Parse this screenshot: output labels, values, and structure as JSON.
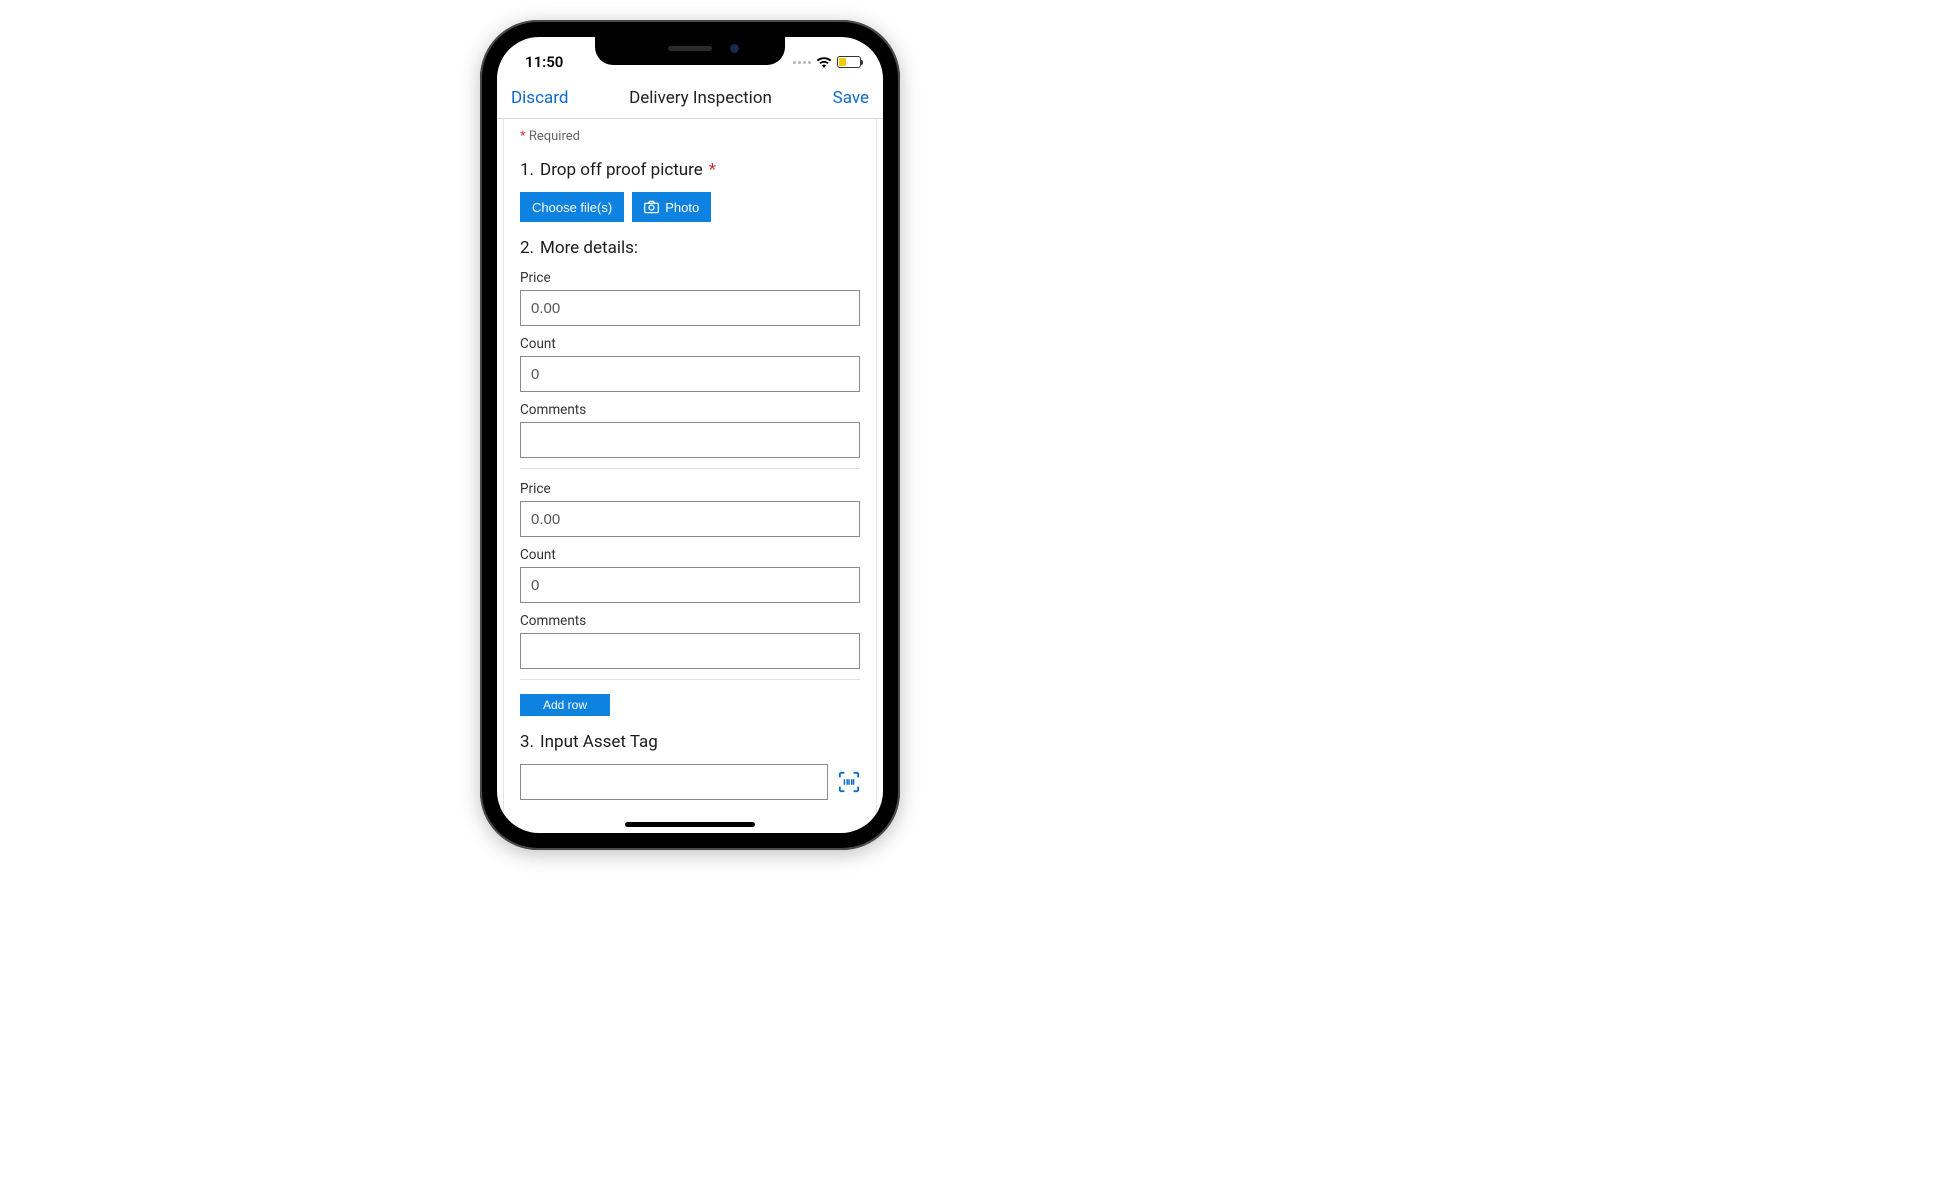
{
  "status": {
    "time": "11:50"
  },
  "nav": {
    "discard": "Discard",
    "title": "Delivery Inspection",
    "save": "Save"
  },
  "required_label": "Required",
  "questions": {
    "q1": {
      "number": "1.",
      "title": "Drop off proof picture",
      "choose_btn": "Choose file(s)",
      "photo_btn": "Photo"
    },
    "q2": {
      "number": "2.",
      "title": "More details:",
      "fields": {
        "price_label": "Price",
        "price_placeholder": "0.00",
        "count_label": "Count",
        "count_placeholder": "0",
        "comments_label": "Comments"
      },
      "add_row": "Add row"
    },
    "q3": {
      "number": "3.",
      "title": "Input Asset Tag"
    }
  }
}
